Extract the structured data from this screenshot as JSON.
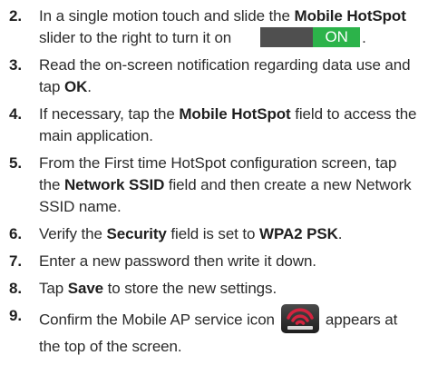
{
  "steps": [
    {
      "number": "2.",
      "parts": {
        "a": "In a single motion touch and slide the ",
        "b": "Mobile HotSpot",
        "c": " slider to the right to turn it on",
        "d": "."
      },
      "toggle_label": "ON"
    },
    {
      "number": "3.",
      "parts": {
        "a": "Read the on-screen notification regarding data use and tap ",
        "b": "OK",
        "c": "."
      }
    },
    {
      "number": "4.",
      "parts": {
        "a": "If necessary, tap the ",
        "b": "Mobile HotSpot",
        "c": " field to access the main application."
      }
    },
    {
      "number": "5.",
      "parts": {
        "a": "From the First time HotSpot configuration screen, tap the ",
        "b": "Network SSID",
        "c": " field and then create a new Network SSID name."
      }
    },
    {
      "number": "6.",
      "parts": {
        "a": "Verify the ",
        "b": "Security",
        "c": " field is set to ",
        "d": "WPA2 PSK",
        "e": "."
      }
    },
    {
      "number": "7.",
      "parts": {
        "a": "Enter a new password then write it down."
      }
    },
    {
      "number": "8.",
      "parts": {
        "a": "Tap ",
        "b": "Save",
        "c": " to store the new settings."
      }
    },
    {
      "number": "9.",
      "parts": {
        "a": "Confirm the Mobile AP service icon",
        "b": "appears at the top of the screen."
      },
      "icon": "mobile-ap-service-icon"
    }
  ],
  "colors": {
    "toggle_on": "#2cb34a",
    "toggle_track": "#4f4f4f",
    "icon_bg": "#2d2d2d",
    "icon_signal": "#d3233f"
  }
}
